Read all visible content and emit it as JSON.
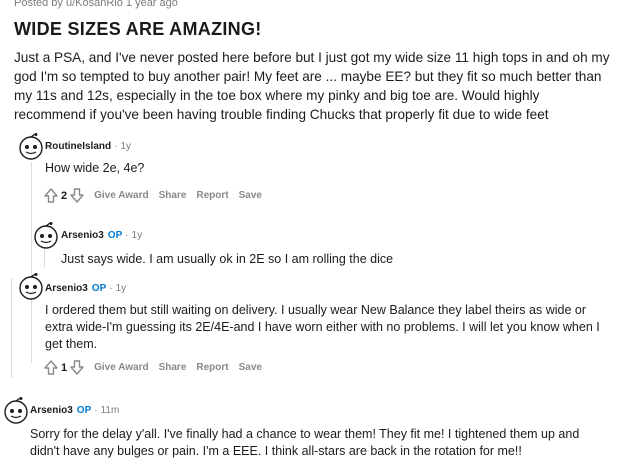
{
  "post": {
    "meta": "Posted by u/KosanRio 1 year ago",
    "title": "WIDE SIZES ARE AMAZING!",
    "body": "Just a PSA, and I've never posted here before but I just got my wide size 11 high tops in and oh my god I'm so tempted to buy another pair! My feet are ... maybe EE? but they fit so much better than my 11s and 12s, especially in the toe box where my pinky and big toe are. Would highly recommend if you've been having trouble finding Chucks that properly fit due to wide feet"
  },
  "comments": [
    {
      "author": "RoutineIsland",
      "op": "",
      "time": "1y",
      "text": "How wide 2e, 4e?",
      "score": "2",
      "actions": {
        "give_award": "Give Award",
        "share": "Share",
        "report": "Report",
        "save": "Save"
      }
    },
    {
      "author": "Arsenio3",
      "op": "OP",
      "time": "1y",
      "text": "Just says wide. I am usually ok in 2E so I am rolling the dice"
    },
    {
      "author": "Arsenio3",
      "op": "OP",
      "time": "1y",
      "text": "I ordered them but still waiting on delivery. I usually wear New Balance they label theirs as wide or extra wide-I'm guessing its 2E/4E-and I have worn either with no problems. I will let you know when I get them.",
      "score": "1",
      "actions": {
        "give_award": "Give Award",
        "share": "Share",
        "report": "Report",
        "save": "Save"
      }
    },
    {
      "author": "Arsenio3",
      "op": "OP",
      "time": "11m",
      "text": "Sorry for the delay y'all. I've finally had a chance to wear them! They fit me! I tightened them up and didn't have any bulges or pain. I'm a EEE. I think all-stars are back in the rotation for me!!"
    }
  ],
  "dot": "·",
  "colors": {
    "op": "#0079d3",
    "meta": "#7c7c7c",
    "action": "#878a8c"
  }
}
